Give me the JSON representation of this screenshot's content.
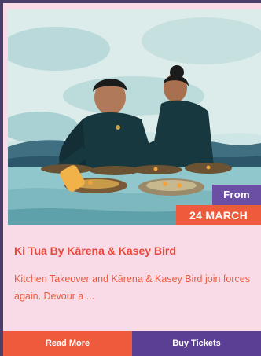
{
  "event": {
    "badge_from": "From",
    "badge_date": "24 MARCH",
    "title": "Ki Tua By Kārena & Kasey Bird",
    "description": "Kitchen Takeover and Kārena & Kasey Bird join forces again. Devour a ..."
  },
  "actions": {
    "read_more_label": "Read More",
    "buy_tickets_label": "Buy Tickets"
  },
  "colors": {
    "card_background": "#f8dbe6",
    "page_background": "#4a3f6b",
    "accent_orange": "#ee5a3c",
    "accent_purple": "#5b3f94"
  }
}
